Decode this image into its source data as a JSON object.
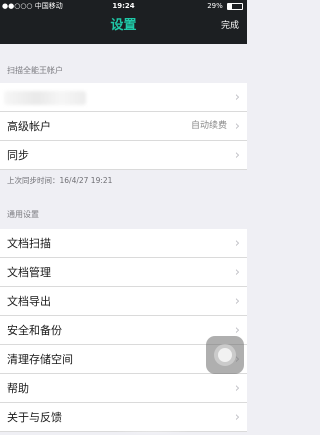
{
  "status_bar": {
    "carrier": "●●○○○ 中国移动 ",
    "time": "19:24",
    "battery": "29%"
  },
  "nav": {
    "title": "设置",
    "done_label": "完成"
  },
  "sections": {
    "account_header": "扫描全能王帐户",
    "premium": {
      "label": "高级帐户",
      "value": "自动续费"
    },
    "sync": {
      "label": "同步"
    },
    "last_sync_note": "上次同步时间：16/4/27 19:21",
    "general_header": "通用设置",
    "general_items": [
      {
        "label": "文档扫描"
      },
      {
        "label": "文档管理"
      },
      {
        "label": "文档导出"
      },
      {
        "label": "安全和备份"
      },
      {
        "label": "清理存储空间"
      },
      {
        "label": "帮助"
      },
      {
        "label": "关于与反馈"
      }
    ]
  },
  "icons": {
    "chevron": "›",
    "wifi": "wifi-icon",
    "battery": "battery-icon"
  },
  "colors": {
    "accent": "#1fc9a8",
    "nav_bg": "#1c1f22",
    "page_bg": "#efeff4"
  }
}
